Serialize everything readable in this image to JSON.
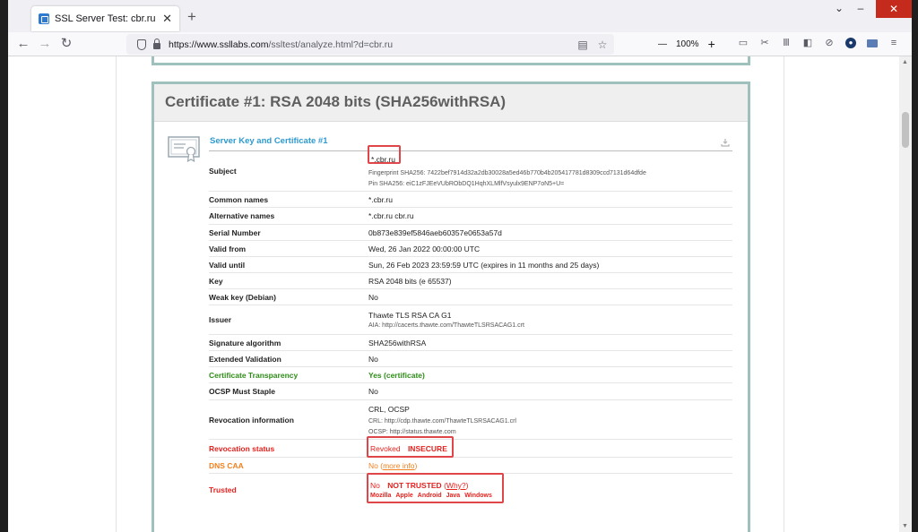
{
  "browser": {
    "tab_title": "SSL Server Test: cbr.ru (Powered",
    "url_host": "https://www.ssllabs.com",
    "url_path": "/ssltest/analyze.html?d=cbr.ru",
    "zoom": "100%",
    "icons": [
      "back-icon",
      "forward-icon",
      "reload-icon",
      "shield-icon",
      "lock-icon",
      "reader-view-icon",
      "bookmark-star-icon",
      "library-icon",
      "sidebar-icon",
      "block-icon",
      "extension-icon",
      "screenshot-icon"
    ]
  },
  "cert": {
    "header": "Certificate #1: RSA 2048 bits (SHA256withRSA)",
    "section_title": "Server Key and Certificate #1",
    "rows": [
      {
        "label": "Subject",
        "value": "*.cbr.ru",
        "sub1": "Fingerprint SHA256: 7422bef7914d32a2db30028a5ed46b770b4b205417781d8309ccd7131d64dfde",
        "sub2": "Pin SHA256: eiC1zFJEeVUbRObDQ1HqhXLMlfVsyulx9ENP7oN5+U="
      },
      {
        "label": "Common names",
        "value": "*.cbr.ru"
      },
      {
        "label": "Alternative names",
        "value": "*.cbr.ru cbr.ru"
      },
      {
        "label": "Serial Number",
        "value": "0b873e839ef5846aeb60357e0653a57d"
      },
      {
        "label": "Valid from",
        "value": "Wed, 26 Jan 2022 00:00:00 UTC"
      },
      {
        "label": "Valid until",
        "value": "Sun, 26 Feb 2023 23:59:59 UTC (expires in 11 months and 25 days)"
      },
      {
        "label": "Key",
        "value": "RSA 2048 bits (e 65537)"
      },
      {
        "label": "Weak key (Debian)",
        "value": "No"
      },
      {
        "label": "Issuer",
        "value": "Thawte TLS RSA CA G1",
        "sub1": "AIA: http://cacerts.thawte.com/ThawteTLSRSACAG1.crt"
      },
      {
        "label": "Signature algorithm",
        "value": "SHA256withRSA"
      },
      {
        "label": "Extended Validation",
        "value": "No"
      },
      {
        "label": "Certificate Transparency",
        "value": "Yes (certificate)"
      },
      {
        "label": "OCSP Must Staple",
        "value": "No"
      },
      {
        "label": "Revocation information",
        "value": "CRL, OCSP",
        "sub1": "CRL: http://cdp.thawte.com/ThawteTLSRSACAG1.crl",
        "sub2": "OCSP: http://status.thawte.com"
      },
      {
        "label": "Revocation status",
        "value": "Revoked",
        "value2": "INSECURE"
      },
      {
        "label": "DNS CAA",
        "value": "No",
        "link": "more info"
      },
      {
        "label": "Trusted",
        "value": "No",
        "value2": "NOT TRUSTED",
        "link": "Why?",
        "platforms": [
          "Mozilla",
          "Apple",
          "Android",
          "Java",
          "Windows"
        ]
      }
    ]
  },
  "colors": {
    "accent_border": "#9fc1bd",
    "red": "#e5211d",
    "green": "#2d8c17",
    "orange": "#f2801f",
    "highlight": "#e0454a"
  }
}
